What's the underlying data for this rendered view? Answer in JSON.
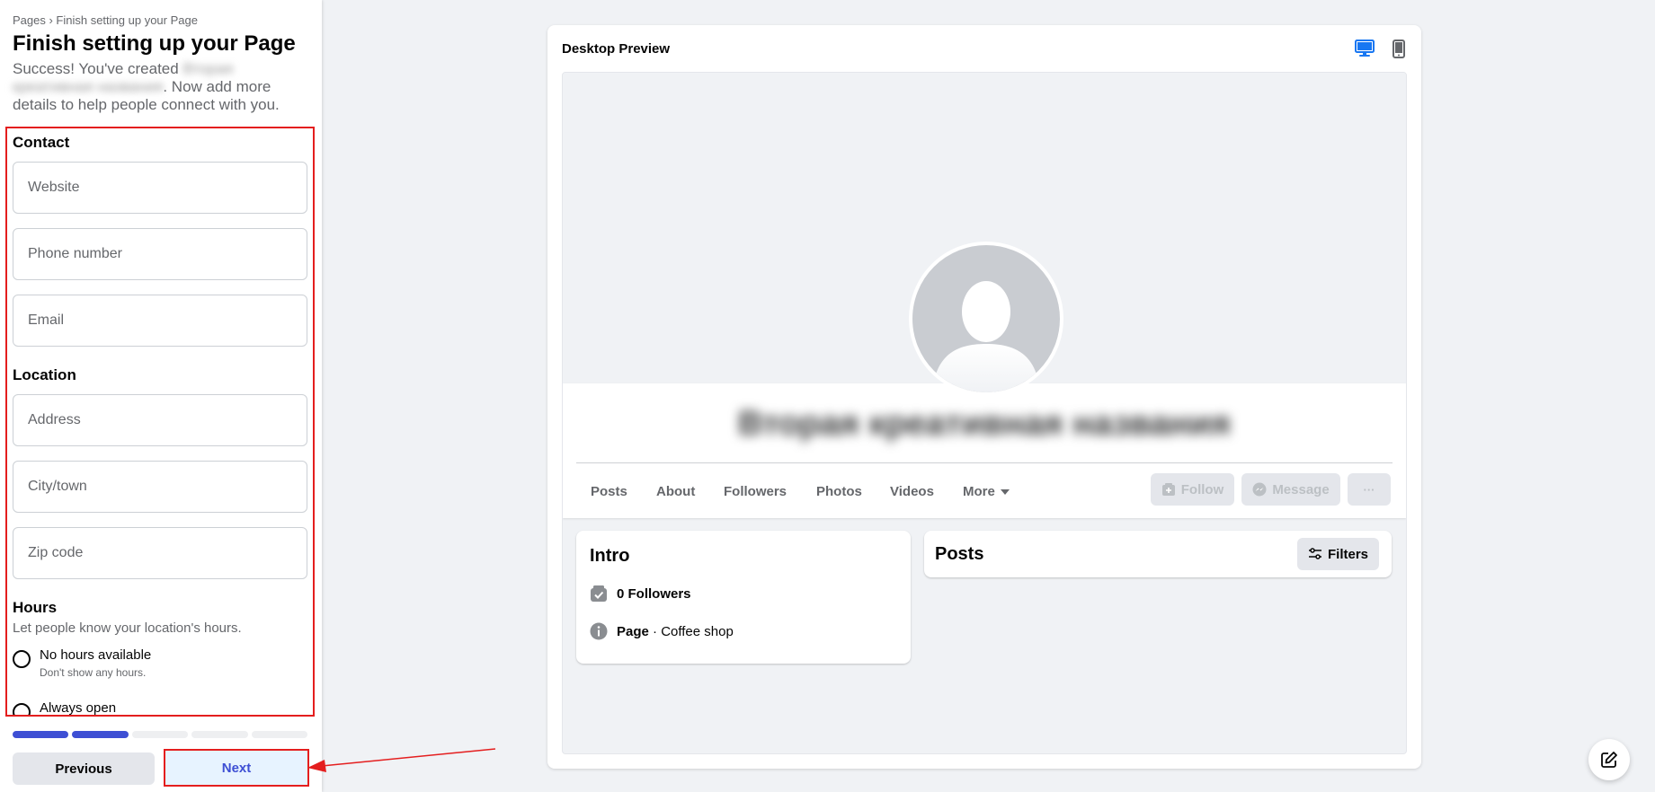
{
  "left_panel": {
    "breadcrumb": "Pages › Finish setting up your Page",
    "title": "Finish setting up your Page",
    "subtitle_prefix": "Success! You've created ",
    "subtitle_page_name": "Вторая креативная названия",
    "subtitle_suffix": ". Now add more details to help people connect with you.",
    "contact": {
      "heading": "Contact",
      "website_placeholder": "Website",
      "phone_placeholder": "Phone number",
      "email_placeholder": "Email"
    },
    "location": {
      "heading": "Location",
      "address_placeholder": "Address",
      "city_placeholder": "City/town",
      "zip_placeholder": "Zip code"
    },
    "hours": {
      "heading": "Hours",
      "description": "Let people know your location's hours.",
      "options": [
        {
          "label": "No hours available",
          "sub": "Don't show any hours."
        },
        {
          "label": "Always open",
          "sub": ""
        }
      ]
    },
    "progress": {
      "total_steps": 5,
      "completed_steps": 2
    },
    "buttons": {
      "previous": "Previous",
      "next": "Next"
    }
  },
  "preview": {
    "title": "Desktop Preview",
    "active_device": "desktop",
    "page_name": "Вторая креативная названия",
    "tabs": [
      "Posts",
      "About",
      "Followers",
      "Photos",
      "Videos",
      "More"
    ],
    "actions": {
      "follow": "Follow",
      "message": "Message",
      "more": "···"
    },
    "intro": {
      "title": "Intro",
      "followers": "0 Followers",
      "page_label": "Page",
      "category": " · Coffee shop"
    },
    "posts": {
      "title": "Posts",
      "filters": "Filters"
    }
  },
  "colors": {
    "accent": "#3e4fd4",
    "annotation_red": "#e41e1e",
    "device_active": "#1877f2",
    "next_bg": "#e7f3ff"
  }
}
